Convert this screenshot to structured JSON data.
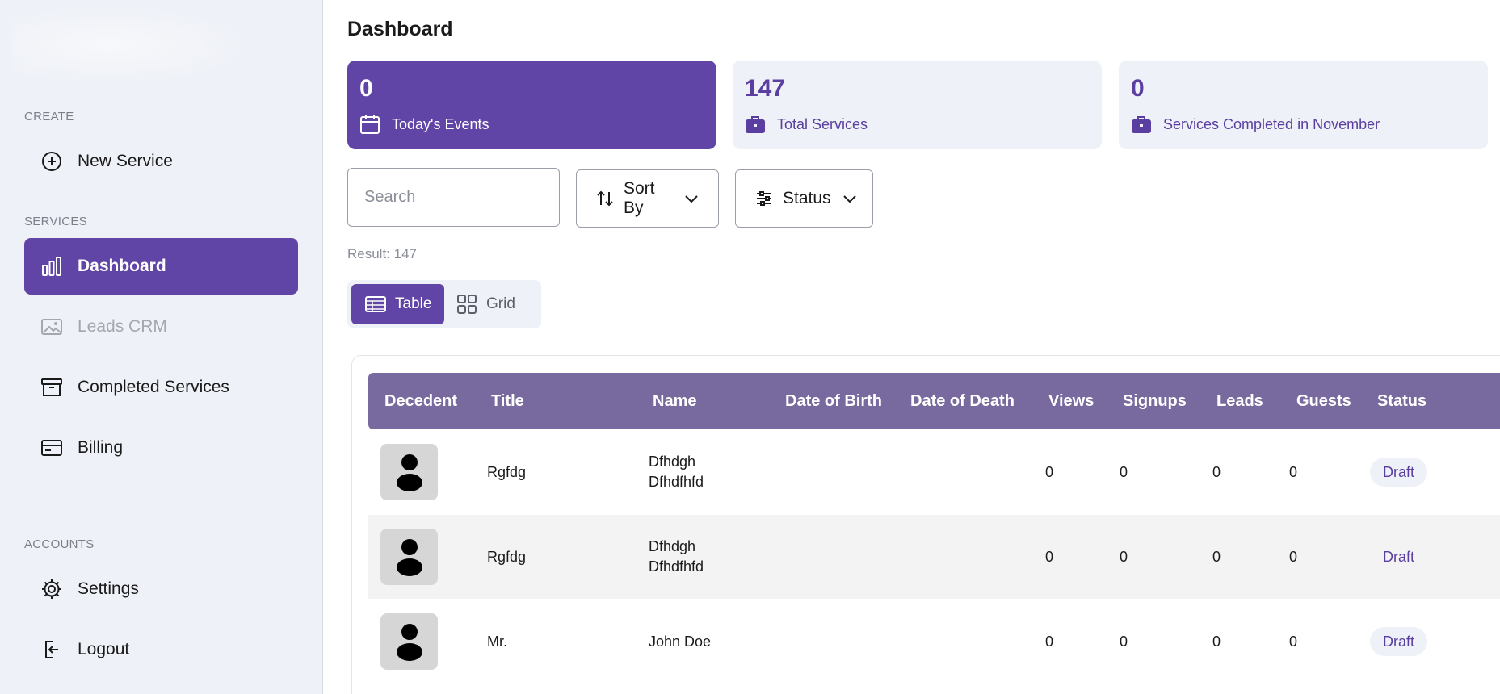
{
  "sidebar": {
    "sections": {
      "create": "CREATE",
      "services": "SERVICES",
      "accounts": "ACCOUNTS"
    },
    "items": [
      {
        "label": "New Service",
        "icon": "plus-circle-icon"
      },
      {
        "label": "Dashboard",
        "icon": "bar-chart-icon",
        "active": true
      },
      {
        "label": "Leads CRM",
        "icon": "image-icon",
        "disabled": true
      },
      {
        "label": "Completed Services",
        "icon": "archive-box-icon"
      },
      {
        "label": "Billing",
        "icon": "credit-card-icon"
      },
      {
        "label": "Settings",
        "icon": "gear-icon"
      },
      {
        "label": "Logout",
        "icon": "logout-icon"
      }
    ]
  },
  "main": {
    "title": "Dashboard",
    "cards": [
      {
        "value": "0",
        "label": "Today's Events",
        "icon": "calendar-icon"
      },
      {
        "value": "147",
        "label": "Total Services",
        "icon": "briefcase-icon"
      },
      {
        "value": "0",
        "label": "Services Completed in November",
        "icon": "briefcase-icon"
      }
    ],
    "search": {
      "placeholder": "Search"
    },
    "sort_label": "Sort By",
    "status_label": "Status",
    "result_text": "Result: 147",
    "view_toggle": {
      "table": "Table",
      "grid": "Grid"
    },
    "table": {
      "columns": [
        "Decedent",
        "Title",
        "Name",
        "Date of Birth",
        "Date of Death",
        "Views",
        "Signups",
        "Leads",
        "Guests",
        "Status"
      ],
      "rows": [
        {
          "title": "Rgfdg",
          "name_first": "Dfhdgh",
          "name_last": "Dfhdfhfd",
          "dob": "",
          "dod": "",
          "views": "0",
          "signups": "0",
          "leads": "0",
          "guests": "0",
          "status": "Draft"
        },
        {
          "title": "Rgfdg",
          "name_first": "Dfhdgh",
          "name_last": "Dfhdfhfd",
          "dob": "",
          "dod": "",
          "views": "0",
          "signups": "0",
          "leads": "0",
          "guests": "0",
          "status": "Draft"
        },
        {
          "title": "Mr.",
          "name_first": "John Doe",
          "name_last": "",
          "dob": "",
          "dod": "",
          "views": "0",
          "signups": "0",
          "leads": "0",
          "guests": "0",
          "status": "Draft"
        }
      ]
    }
  },
  "colors": {
    "accent": "#6145a6",
    "table_header": "#786a9f",
    "sidebar_bg": "#eef1f7"
  }
}
